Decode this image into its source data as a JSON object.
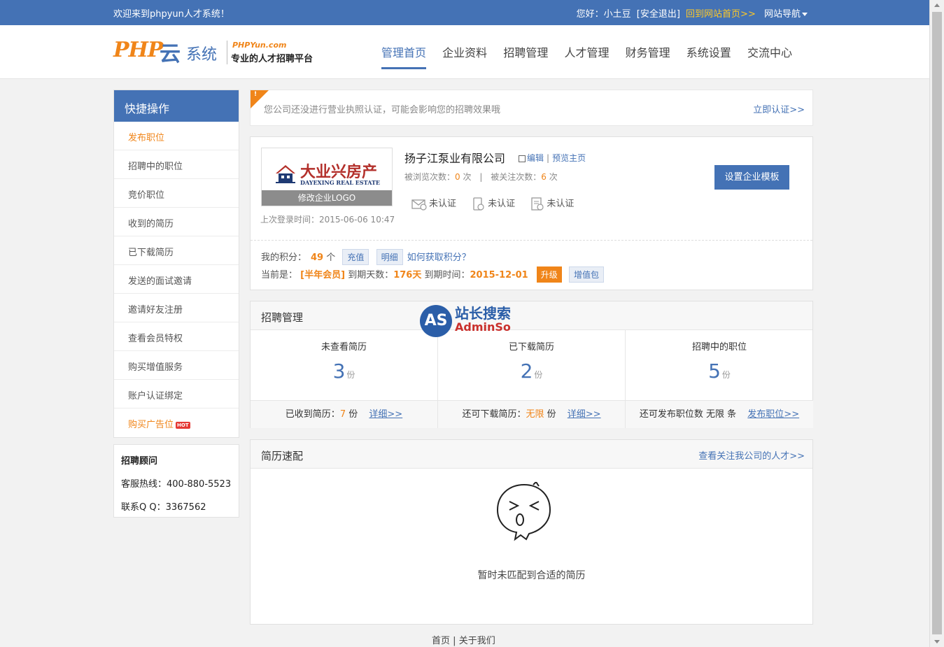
{
  "topbar": {
    "welcome": "欢迎来到phpyun人才系统！",
    "greeting": "您好：小土豆",
    "logout": "[安全退出]",
    "home_link": "回到网站首页>>",
    "site_nav": "网站导航"
  },
  "header": {
    "logo_php": "PHP",
    "logo_yun": "云",
    "logo_sys": "系统",
    "logo_brand": "PHPYun.com",
    "logo_slogan": "专业的人才招聘平台",
    "nav": [
      {
        "label": "管理首页",
        "active": true
      },
      {
        "label": "企业资料"
      },
      {
        "label": "招聘管理"
      },
      {
        "label": "人才管理"
      },
      {
        "label": "财务管理"
      },
      {
        "label": "系统设置"
      },
      {
        "label": "交流中心"
      }
    ]
  },
  "sidebar": {
    "title": "快捷操作",
    "items": [
      {
        "label": "发布职位"
      },
      {
        "label": "招聘中的职位"
      },
      {
        "label": "竞价职位"
      },
      {
        "label": "收到的简历"
      },
      {
        "label": "已下载简历"
      },
      {
        "label": "发送的面试邀请"
      },
      {
        "label": "邀请好友注册"
      },
      {
        "label": "查看会员特权"
      },
      {
        "label": "购买增值服务"
      },
      {
        "label": "账户认证绑定"
      },
      {
        "label": "购买广告位"
      }
    ],
    "hot_badge": "HOT",
    "advisor": {
      "title": "招聘顾问",
      "hotline": "客服热线：400-880-5523",
      "qq": "联系Q Q：3367562"
    }
  },
  "notice": {
    "corner": "!",
    "message": "您公司还没进行营业执照认证，可能会影响您的招聘效果哦",
    "action": "立即认证>>"
  },
  "company": {
    "logo_main": "大业兴房产",
    "logo_sub": "DAYEXING REAL ESTATE",
    "logo_edit": "修改企业LOGO",
    "last_login": "上次登录时间：2015-06-06 10:47",
    "name": "扬子江泵业有限公司",
    "edit": "编辑",
    "preview": "预览主页",
    "views_label": "被浏览次数：",
    "views": "0",
    "views_unit": "次",
    "follows_label": "被关注次数：",
    "follows": "6",
    "follows_unit": "次",
    "certs": [
      {
        "icon": "email-cert-icon",
        "label": "未认证"
      },
      {
        "icon": "phone-cert-icon",
        "label": "未认证"
      },
      {
        "icon": "license-cert-icon",
        "label": "未认证"
      }
    ],
    "template_button": "设置企业模板",
    "points_label": "我的积分：",
    "points": "49",
    "points_unit": "个",
    "recharge": "充值",
    "detail": "明细",
    "howto": "如何获取积分？",
    "member_prefix": "当前是：",
    "member_level": "[半年会员]",
    "days_label": "到期天数：",
    "days": "176天",
    "expire_label": "到期时间：",
    "expire": "2015-12-01",
    "upgrade": "升级",
    "addon": "增值包"
  },
  "recruit": {
    "title": "招聘管理",
    "stats": [
      {
        "label": "未查看简历",
        "value": "3",
        "unit": "份",
        "foot_label": "已收到简历：",
        "foot_value": "7",
        "foot_unit": "份",
        "link": "详细>>"
      },
      {
        "label": "已下载简历",
        "value": "2",
        "unit": "份",
        "foot_label": "还可下载简历：",
        "foot_value": "无限",
        "foot_unit": "份",
        "link": "详细>>"
      },
      {
        "label": "招聘中的职位",
        "value": "5",
        "unit": "份",
        "foot_label": "还可发布职位数 无限 条",
        "foot_value": "",
        "foot_unit": "",
        "link": "发布职位>>"
      }
    ]
  },
  "watermark": {
    "circle": "AS",
    "cn": "站长搜索",
    "en": "AdminSo"
  },
  "match": {
    "title": "简历速配",
    "more": "查看关注我公司的人才>>",
    "empty": "暂时未匹配到合适的简历"
  },
  "footer": {
    "home": "首页",
    "sep": "|",
    "about": "关于我们"
  }
}
